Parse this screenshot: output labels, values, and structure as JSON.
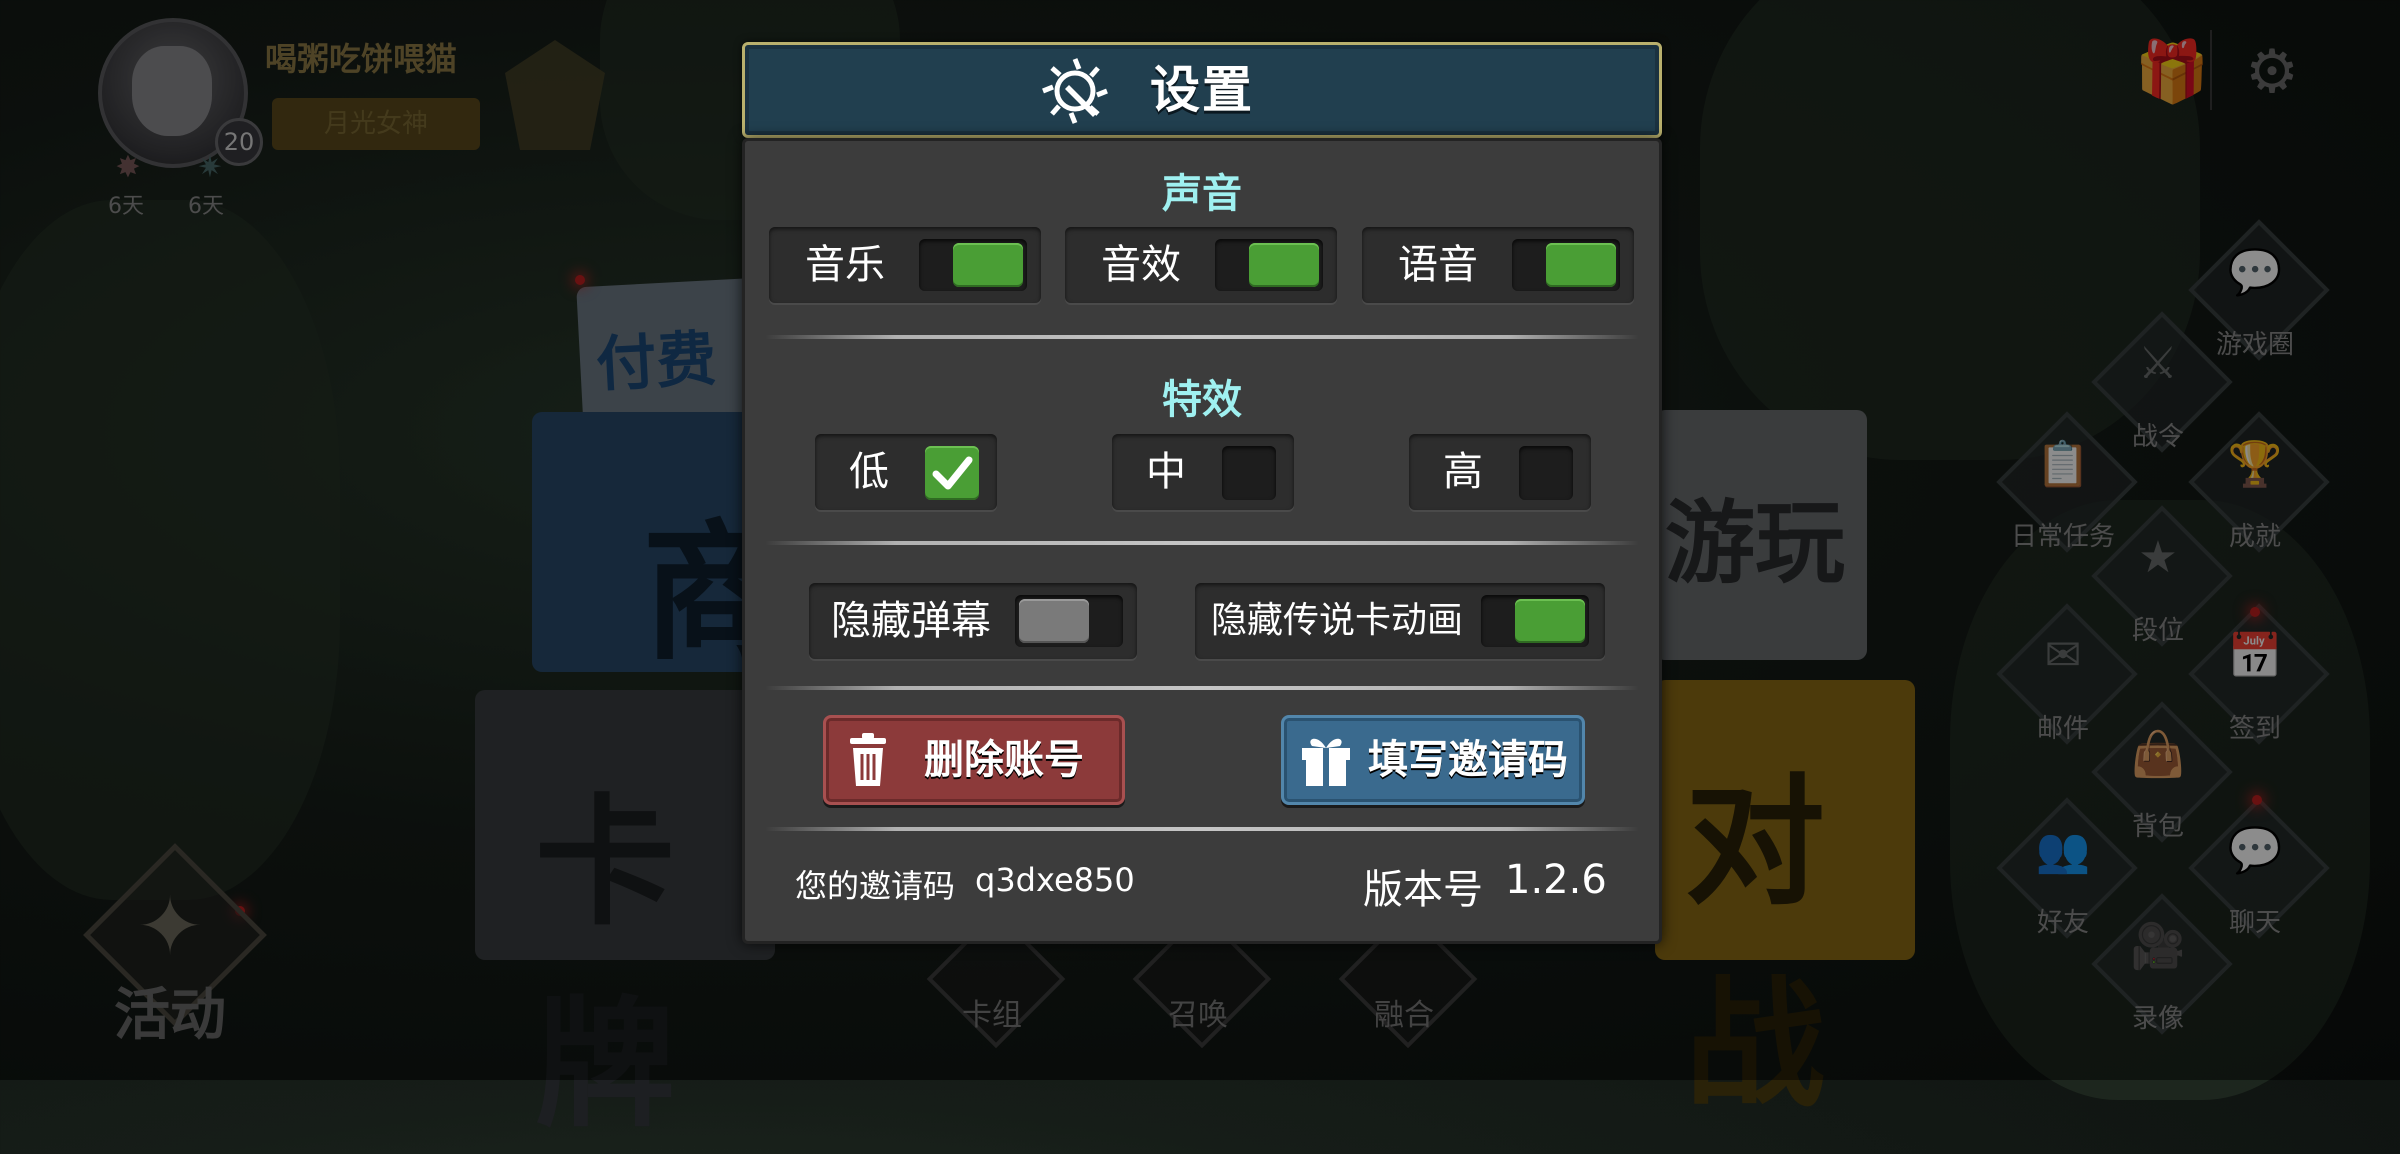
{
  "profile": {
    "player_name": "喝粥吃饼喂猫",
    "title_badge": "月光女神",
    "level": "20",
    "streaks": [
      {
        "label": "6天",
        "icon": "burst-icon"
      },
      {
        "label": "6天",
        "icon": "star-icon"
      }
    ]
  },
  "top_right": {
    "gift_icon": "🎁",
    "settings_icon": "⚙"
  },
  "background_cards": {
    "paid": "付费",
    "shop": "商",
    "cards": "卡牌",
    "play": "游玩",
    "battle": "对战"
  },
  "side_menu": [
    {
      "label": "游戏圈",
      "glyph": "💬",
      "icon": "chat-bubble-icon"
    },
    {
      "label": "战令",
      "glyph": "⚔",
      "icon": "battle-pass-icon"
    },
    {
      "label": "日常任务",
      "glyph": "📋",
      "icon": "clipboard-icon"
    },
    {
      "label": "成就",
      "glyph": "🏆",
      "icon": "trophy-icon"
    },
    {
      "label": "段位",
      "glyph": "★",
      "icon": "rank-star-icon"
    },
    {
      "label": "邮件",
      "glyph": "✉",
      "icon": "mail-icon"
    },
    {
      "label": "签到",
      "glyph": "📅",
      "icon": "calendar-check-icon"
    },
    {
      "label": "背包",
      "glyph": "👜",
      "icon": "bag-icon"
    },
    {
      "label": "好友",
      "glyph": "👥",
      "icon": "friends-icon"
    },
    {
      "label": "聊天",
      "glyph": "💬",
      "icon": "chat-icon"
    },
    {
      "label": "录像",
      "glyph": "🎥",
      "icon": "video-camera-icon"
    }
  ],
  "bottom_bar": [
    {
      "label": "卡组",
      "icon": "deck-icon"
    },
    {
      "label": "召唤",
      "icon": "summon-icon"
    },
    {
      "label": "融合",
      "icon": "fusion-icon"
    }
  ],
  "activity": {
    "label": "活动",
    "glyph": "✦"
  },
  "settings": {
    "title": "设置",
    "sound": {
      "heading": "声音",
      "items": [
        {
          "label": "音乐",
          "on": true
        },
        {
          "label": "音效",
          "on": true
        },
        {
          "label": "语音",
          "on": true
        }
      ]
    },
    "effects": {
      "heading": "特效",
      "options": [
        {
          "label": "低",
          "checked": true
        },
        {
          "label": "中",
          "checked": false
        },
        {
          "label": "高",
          "checked": false
        }
      ]
    },
    "toggles": [
      {
        "label": "隐藏弹幕",
        "on": false
      },
      {
        "label": "隐藏传说卡动画",
        "on": true
      }
    ],
    "delete_account_label": "删除账号",
    "invite_code_button_label": "填写邀请码",
    "invite_code_prefix": "您的邀请码",
    "invite_code": "q3dxe850",
    "version_prefix": "版本号",
    "version": "1.2.6"
  },
  "colors": {
    "toggle_on": "#4a9e35",
    "toggle_off": "#7a7a7a",
    "section_heading": "#9ff0f0",
    "header_bg": "#213f4f",
    "header_border": "#b9b06d",
    "danger_button": "#8c3a3a",
    "info_button": "#3a6a8e"
  }
}
